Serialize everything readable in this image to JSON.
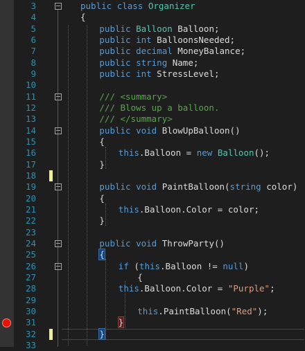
{
  "editor": {
    "lines": [
      {
        "number": "3",
        "tokens": [
          {
            "t": "public",
            "c": "kw"
          },
          {
            "t": " "
          },
          {
            "t": "class",
            "c": "kw"
          },
          {
            "t": " "
          },
          {
            "t": "Organizer",
            "c": "ty"
          }
        ]
      },
      {
        "number": "4",
        "tokens": [
          {
            "t": "{"
          }
        ]
      },
      {
        "number": "5",
        "tokens": [
          {
            "t": "public",
            "c": "kw"
          },
          {
            "t": " "
          },
          {
            "t": "Balloon",
            "c": "ty"
          },
          {
            "t": " Balloon;"
          }
        ]
      },
      {
        "number": "6",
        "tokens": [
          {
            "t": "public",
            "c": "kw"
          },
          {
            "t": " "
          },
          {
            "t": "int",
            "c": "kw"
          },
          {
            "t": " BalloonsNeeded;"
          }
        ]
      },
      {
        "number": "7",
        "tokens": [
          {
            "t": "public",
            "c": "kw"
          },
          {
            "t": " "
          },
          {
            "t": "decimal",
            "c": "kw"
          },
          {
            "t": " MoneyBalance;"
          }
        ]
      },
      {
        "number": "8",
        "tokens": [
          {
            "t": "public",
            "c": "kw"
          },
          {
            "t": " "
          },
          {
            "t": "string",
            "c": "kw"
          },
          {
            "t": " Name;"
          }
        ]
      },
      {
        "number": "9",
        "tokens": [
          {
            "t": "public",
            "c": "kw"
          },
          {
            "t": " "
          },
          {
            "t": "int",
            "c": "kw"
          },
          {
            "t": " StressLevel;"
          }
        ]
      },
      {
        "number": "10",
        "tokens": []
      },
      {
        "number": "11",
        "tokens": [
          {
            "t": "/// <summary>",
            "c": "cm"
          }
        ]
      },
      {
        "number": "12",
        "tokens": [
          {
            "t": "/// Blows up a balloon.",
            "c": "cm"
          }
        ]
      },
      {
        "number": "13",
        "tokens": [
          {
            "t": "/// </summary>",
            "c": "cm"
          }
        ]
      },
      {
        "number": "14",
        "tokens": [
          {
            "t": "public",
            "c": "kw"
          },
          {
            "t": " "
          },
          {
            "t": "void",
            "c": "kw"
          },
          {
            "t": " BlowUpBalloon()"
          }
        ]
      },
      {
        "number": "15",
        "tokens": [
          {
            "t": "{"
          }
        ]
      },
      {
        "number": "16",
        "tokens": [
          {
            "t": "this",
            "c": "kw"
          },
          {
            "t": ".Balloon = "
          },
          {
            "t": "new",
            "c": "kw"
          },
          {
            "t": " "
          },
          {
            "t": "Balloon",
            "c": "ty"
          },
          {
            "t": "();"
          }
        ]
      },
      {
        "number": "17",
        "tokens": [
          {
            "t": "}"
          }
        ]
      },
      {
        "number": "18",
        "tokens": []
      },
      {
        "number": "19",
        "tokens": [
          {
            "t": "public",
            "c": "kw"
          },
          {
            "t": " "
          },
          {
            "t": "void",
            "c": "kw"
          },
          {
            "t": " PaintBalloon("
          },
          {
            "t": "string",
            "c": "kw"
          },
          {
            "t": " color)"
          }
        ]
      },
      {
        "number": "20",
        "tokens": [
          {
            "t": "{"
          }
        ]
      },
      {
        "number": "21",
        "tokens": [
          {
            "t": "this",
            "c": "kw"
          },
          {
            "t": ".Balloon.Color = color;"
          }
        ]
      },
      {
        "number": "22",
        "tokens": [
          {
            "t": "}"
          }
        ]
      },
      {
        "number": "23",
        "tokens": []
      },
      {
        "number": "24",
        "tokens": [
          {
            "t": "public",
            "c": "kw"
          },
          {
            "t": " "
          },
          {
            "t": "void",
            "c": "kw"
          },
          {
            "t": " ThrowParty()"
          }
        ]
      },
      {
        "number": "25",
        "tokens": [
          {
            "t": "{",
            "c": "brace-hl"
          }
        ]
      },
      {
        "number": "26",
        "tokens": [
          {
            "t": "if",
            "c": "kw"
          },
          {
            "t": " ("
          },
          {
            "t": "this",
            "c": "kw"
          },
          {
            "t": ".Balloon != "
          },
          {
            "t": "null",
            "c": "kw"
          },
          {
            "t": ")"
          }
        ]
      },
      {
        "number": "27",
        "tokens": [
          {
            "t": "{"
          }
        ]
      },
      {
        "number": "28",
        "tokens": [
          {
            "t": "this",
            "c": "kw"
          },
          {
            "t": ".Balloon.Color = "
          },
          {
            "t": "\"Purple\"",
            "c": "st"
          },
          {
            "t": ";"
          }
        ]
      },
      {
        "number": "29",
        "tokens": []
      },
      {
        "number": "30",
        "tokens": [
          {
            "t": "this",
            "c": "kw"
          },
          {
            "t": ".PaintBalloon("
          },
          {
            "t": "\"Red\"",
            "c": "st"
          },
          {
            "t": ");"
          }
        ]
      },
      {
        "number": "31",
        "tokens": [
          {
            "t": "}",
            "c": "brace-hl-red"
          }
        ]
      },
      {
        "number": "32",
        "tokens": [
          {
            "t": "}",
            "c": "brace-hl"
          }
        ]
      },
      {
        "number": "33",
        "tokens": []
      }
    ]
  },
  "colors": {
    "background": "#1e1e1e",
    "keyword": "#569cd6",
    "type": "#4ec9b0",
    "comment": "#57a64a",
    "string": "#d69d85",
    "line_number": "#2b91af",
    "breakpoint": "#e51400",
    "modified_marker": "#efef91"
  },
  "icons": {
    "fold": "collapse-minus-icon",
    "breakpoint": "breakpoint-icon"
  }
}
